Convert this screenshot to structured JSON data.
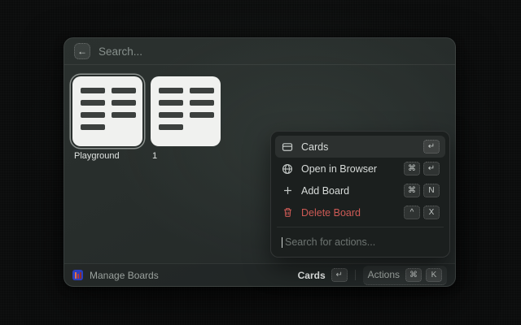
{
  "search": {
    "placeholder": "Search..."
  },
  "boards": [
    {
      "label": "Playground",
      "selected": true
    },
    {
      "label": "1",
      "selected": false
    }
  ],
  "actions_panel": {
    "items": [
      {
        "label": "Cards",
        "icon": "card-icon",
        "keys": [
          "↵"
        ],
        "selected": true,
        "danger": false
      },
      {
        "label": "Open in Browser",
        "icon": "globe-icon",
        "keys": [
          "⌘",
          "↵"
        ],
        "selected": false,
        "danger": false
      },
      {
        "label": "Add Board",
        "icon": "plus-icon",
        "keys": [
          "⌘",
          "N"
        ],
        "selected": false,
        "danger": false
      },
      {
        "label": "Delete Board",
        "icon": "trash-icon",
        "keys": [
          "^",
          "X"
        ],
        "selected": false,
        "danger": true
      }
    ],
    "search_placeholder": "Search for actions..."
  },
  "footer": {
    "app_name": "Manage Boards",
    "primary_action_label": "Cards",
    "primary_action_key": "↵",
    "secondary_action_label": "Actions",
    "secondary_action_keys": [
      "⌘",
      "K"
    ]
  },
  "colors": {
    "danger_red": "#cd5a55",
    "board_card_bg": "#f0f1ef",
    "board_bar": "#3c403e",
    "window_bg": "#272d2b",
    "panel_bg": "#1b1f1e",
    "app_icon_blue": "#2b3fc0"
  }
}
